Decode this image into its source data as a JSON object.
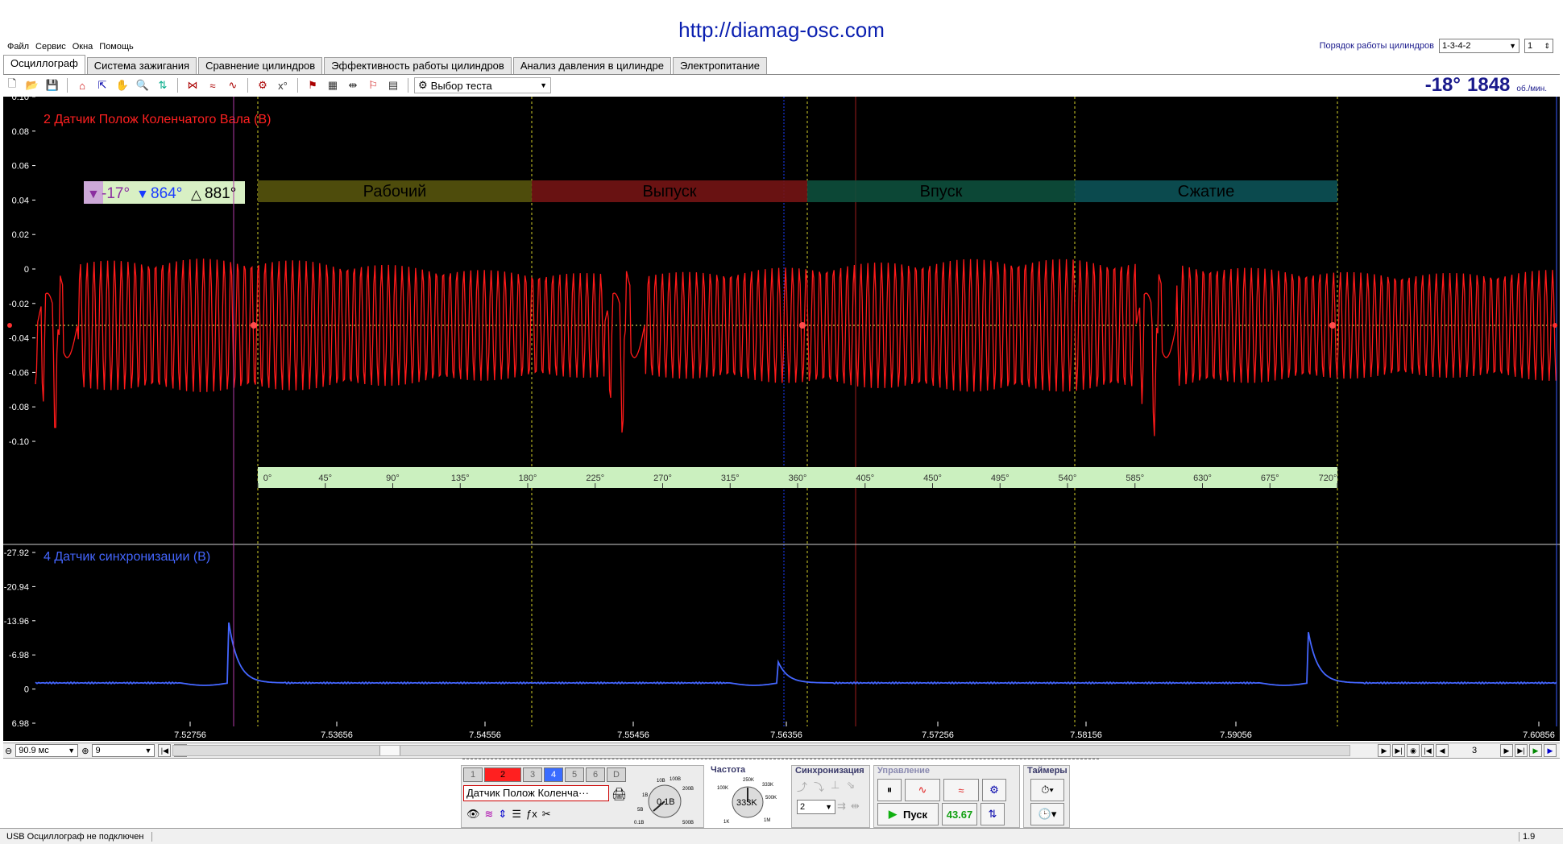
{
  "site_url": "http://diamag-osc.com",
  "menu": [
    "Файл",
    "Сервис",
    "Окна",
    "Помощь"
  ],
  "cylinder_order": {
    "label": "Порядок работы цилиндров",
    "value": "1-3-4-2",
    "count": "1"
  },
  "tabs": [
    "Осциллограф",
    "Система зажигания",
    "Сравнение цилиндров",
    "Эффективность работы цилиндров",
    "Анализ давления в цилиндре",
    "Электропитание"
  ],
  "active_tab": 0,
  "toolbar": {
    "test_select": "Выбор теста"
  },
  "rpm": {
    "angle": "-18°",
    "value": "1848",
    "unit": "об./мин."
  },
  "channel_top": {
    "title": "2 Датчик Полож Коленчатого Вала (В)",
    "color": "#ff1a1a",
    "y_ticks": [
      "0.10",
      "0.08",
      "0.06",
      "0.04",
      "0.02",
      "0",
      "-0.02",
      "-0.04",
      "-0.06",
      "-0.08",
      "-0.10"
    ]
  },
  "markers": {
    "m1": "-17°",
    "m2": "864°",
    "delta": "881°"
  },
  "phases": [
    {
      "label": "Рабочий",
      "color": "#57540d"
    },
    {
      "label": "Выпуск",
      "color": "#741414"
    },
    {
      "label": "Впуск",
      "color": "#0d4f3c"
    },
    {
      "label": "Сжатие",
      "color": "#0c5257"
    }
  ],
  "degree_scale": [
    "0°",
    "45°",
    "90°",
    "135°",
    "180°",
    "225°",
    "270°",
    "315°",
    "360°",
    "405°",
    "450°",
    "495°",
    "540°",
    "585°",
    "630°",
    "675°",
    "720°"
  ],
  "channel_bottom": {
    "title": "4 Датчик синхронизации (В)",
    "color": "#3a5cff",
    "y_ticks": [
      "-27.92",
      "-20.94",
      "-13.96",
      "-6.98",
      "0",
      "6.98"
    ]
  },
  "x_ticks": [
    "7.52756",
    "7.53656",
    "7.54556",
    "7.55456",
    "7.56356",
    "7.57256",
    "7.58156",
    "7.59056",
    "7.60856"
  ],
  "bottom_nav": {
    "timebase": "90.9 мс",
    "channel_count": "9",
    "page": "3"
  },
  "control": {
    "channels": [
      "1",
      "2",
      "3",
      "4",
      "5",
      "6",
      "D"
    ],
    "source": "Датчик Полож Коленча···",
    "range_value": "0.1В",
    "range_marks": [
      "10В",
      "100В",
      "200В",
      "500В",
      "0.1В",
      "1В",
      "5В"
    ],
    "freq_title": "Частота",
    "freq_value": "333K",
    "freq_marks": [
      "250K",
      "333K",
      "500K",
      "100K",
      "1K",
      "1M"
    ],
    "sync_title": "Синхронизация",
    "sync_value": "2",
    "mgmt_title": "Управление",
    "start_label": "Пуск",
    "freq_display": "43.67",
    "timers_title": "Таймеры"
  },
  "status": {
    "left": "USB Осциллограф не подключен",
    "right": "1.9"
  }
}
